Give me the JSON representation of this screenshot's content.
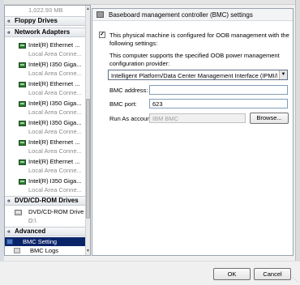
{
  "nav": {
    "top_partial": "1,022.93 MB",
    "sections": {
      "floppy": "Floppy Drives",
      "network": "Network Adapters",
      "dvd": "DVD/CD-ROM Drives",
      "advanced": "Advanced"
    },
    "adapters": [
      {
        "name": "Intel(R) Ethernet ...",
        "status": "Local Area Conne..."
      },
      {
        "name": "Intel(R) I350 Giga...",
        "status": "Local Area Conne..."
      },
      {
        "name": "Intel(R) Ethernet ...",
        "status": "Local Area Conne..."
      },
      {
        "name": "Intel(R) I350 Giga...",
        "status": "Local Area Conne..."
      },
      {
        "name": "Intel(R) I350 Giga...",
        "status": "Local Area Conne..."
      },
      {
        "name": "Intel(R) Ethernet ...",
        "status": "Local Area Conne..."
      },
      {
        "name": "Intel(R) Ethernet ...",
        "status": "Local Area Conne..."
      },
      {
        "name": "Intel(R) I350 Giga...",
        "status": "Local Area Conne..."
      }
    ],
    "dvd_item": {
      "name": "DVD/CD-ROM Drive",
      "status": "D:\\"
    },
    "advanced_items": [
      "BMC Setting",
      "BMC Logs"
    ],
    "selected": "BMC Setting"
  },
  "panel": {
    "title": "Baseboard management controller (BMC) settings",
    "oob_checkbox_line1": "This physical machine is configured for OOB management with the",
    "oob_checkbox_line2": "following settings:",
    "oob_checked": true,
    "provider_line1": "This computer supports the specified OOB power management",
    "provider_line2": "configuration provider:",
    "provider_value": "Intelligent Platform/Data Center Management Interface (IPMI/DCMI)",
    "bmc_address_label": "BMC address:",
    "bmc_address_value": "",
    "bmc_port_label": "BMC port:",
    "bmc_port_value": "623",
    "run_as_label": "Run As account:",
    "run_as_value": "IBM BMC",
    "browse_label": "Browse..."
  },
  "buttons": {
    "ok": "OK",
    "cancel": "Cancel"
  }
}
